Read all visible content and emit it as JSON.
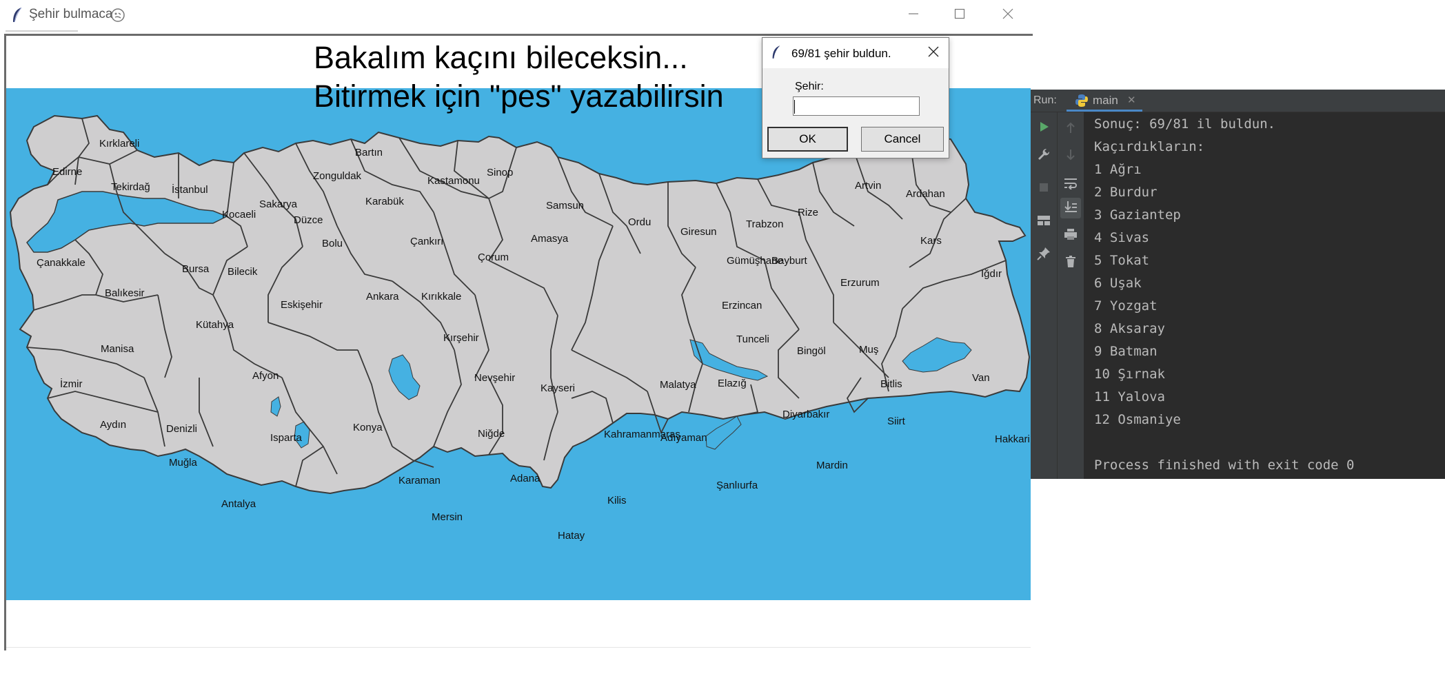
{
  "window": {
    "title": "Şehir bulmaca",
    "minimize_glyph": "—",
    "maximize_glyph": "☐",
    "close_glyph": "✕"
  },
  "heading": {
    "line1": "Bakalım kaçını bileceksin...",
    "line2": "Bitirmek için \"pes\" yazabilirsin"
  },
  "colors": {
    "sea": "#45b1e2",
    "land": "#cfcecf",
    "border": "#3a3a3a",
    "console_bg": "#2b2b2b",
    "console_text": "#bbbbbb",
    "run_icon": "#59a869",
    "tab_underline": "#4a88c7"
  },
  "cities": [
    {
      "name": "Kırklareli"
    },
    {
      "name": "Edirne"
    },
    {
      "name": "Tekirdağ"
    },
    {
      "name": "İstanbul"
    },
    {
      "name": "Kocaeli"
    },
    {
      "name": "Sakarya"
    },
    {
      "name": "Düzce"
    },
    {
      "name": "Zonguldak"
    },
    {
      "name": "Bartın"
    },
    {
      "name": "Karabük"
    },
    {
      "name": "Kastamonu"
    },
    {
      "name": "Sinop"
    },
    {
      "name": "Samsun"
    },
    {
      "name": "Çankırı"
    },
    {
      "name": "Bolu"
    },
    {
      "name": "Çorum"
    },
    {
      "name": "Amasya"
    },
    {
      "name": "Ordu"
    },
    {
      "name": "Giresun"
    },
    {
      "name": "Trabzon"
    },
    {
      "name": "Rize"
    },
    {
      "name": "Artvin"
    },
    {
      "name": "Ardahan"
    },
    {
      "name": "Kars"
    },
    {
      "name": "Iğdır"
    },
    {
      "name": "Erzurum"
    },
    {
      "name": "Gümüşhane"
    },
    {
      "name": "Bayburt"
    },
    {
      "name": "Erzincan"
    },
    {
      "name": "Çanakkale"
    },
    {
      "name": "Balıkesir"
    },
    {
      "name": "Bursa"
    },
    {
      "name": "Bilecik"
    },
    {
      "name": "Eskişehir"
    },
    {
      "name": "Ankara"
    },
    {
      "name": "Kırıkkale"
    },
    {
      "name": "Kütahya"
    },
    {
      "name": "Manisa"
    },
    {
      "name": "İzmir"
    },
    {
      "name": "Afyon"
    },
    {
      "name": "Kırşehir"
    },
    {
      "name": "Nevşehir"
    },
    {
      "name": "Kayseri"
    },
    {
      "name": "Tunceli"
    },
    {
      "name": "Bingöl"
    },
    {
      "name": "Muş"
    },
    {
      "name": "Malatya"
    },
    {
      "name": "Elazığ"
    },
    {
      "name": "Bitlis"
    },
    {
      "name": "Van"
    },
    {
      "name": "Aydın"
    },
    {
      "name": "Denizli"
    },
    {
      "name": "Isparta"
    },
    {
      "name": "Konya"
    },
    {
      "name": "Niğde"
    },
    {
      "name": "Diyarbakır"
    },
    {
      "name": "Siirt"
    },
    {
      "name": "Hakkari"
    },
    {
      "name": "Kahramanmaraş"
    },
    {
      "name": "Adıyaman"
    },
    {
      "name": "Muğla"
    },
    {
      "name": "Karaman"
    },
    {
      "name": "Adana"
    },
    {
      "name": "Mardin"
    },
    {
      "name": "Şanlıurfa"
    },
    {
      "name": "Antalya"
    },
    {
      "name": "Mersin"
    },
    {
      "name": "Kilis"
    },
    {
      "name": "Hatay"
    }
  ],
  "dialog": {
    "title": "69/81 şehir buldun.",
    "label": "Şehir:",
    "input_value": "",
    "ok_label": "OK",
    "cancel_label": "Cancel"
  },
  "run_panel": {
    "label": "Run:",
    "tab_name": "main",
    "tab_close": "✕",
    "output": [
      "Sonuç: 69/81 il buldun.",
      "Kaçırdıkların:",
      "1 Ağrı",
      "2 Burdur",
      "3 Gaziantep",
      "4 Sivas",
      "5 Tokat",
      "6 Uşak",
      "7 Yozgat",
      "8 Aksaray",
      "9 Batman",
      "10 Şırnak",
      "11 Yalova",
      "12 Osmaniye",
      "",
      "Process finished with exit code 0"
    ]
  },
  "icons": [
    "feather-icon",
    "emoji-icon",
    "minimize-icon",
    "maximize-icon",
    "close-icon",
    "python-icon",
    "rerun-icon",
    "wrench-icon",
    "stop-icon",
    "layout-icon",
    "pin-icon",
    "arrow-up-icon",
    "arrow-down-icon",
    "soft-wrap-icon",
    "scroll-end-icon",
    "print-icon",
    "trash-icon"
  ]
}
